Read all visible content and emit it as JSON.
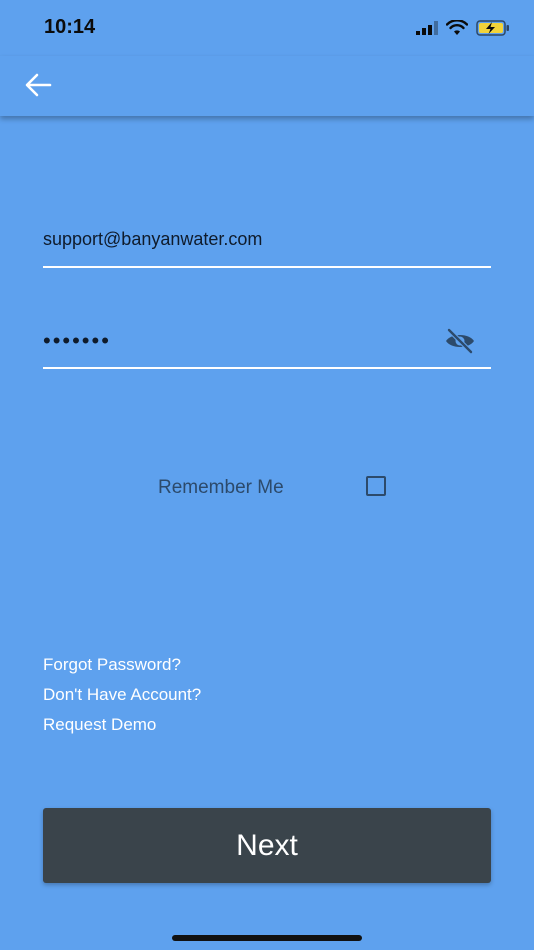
{
  "status_bar": {
    "time": "10:14"
  },
  "login": {
    "email_value": "support@banyanwater.com",
    "password_value": "•••••••",
    "remember_label": "Remember Me",
    "remember_checked": false
  },
  "links": {
    "forgot": "Forgot Password?",
    "no_account": "Don't Have Account?",
    "demo": "Request Demo"
  },
  "next_label": "Next",
  "icons": {
    "back": "arrow-left-icon",
    "visibility": "eye-off-icon",
    "signal": "signal-icon",
    "wifi": "wifi-icon",
    "battery": "battery-charging-icon"
  },
  "colors": {
    "background": "#5ea1ee",
    "button": "#3a444b",
    "text_dark": "#2c4a6b"
  }
}
